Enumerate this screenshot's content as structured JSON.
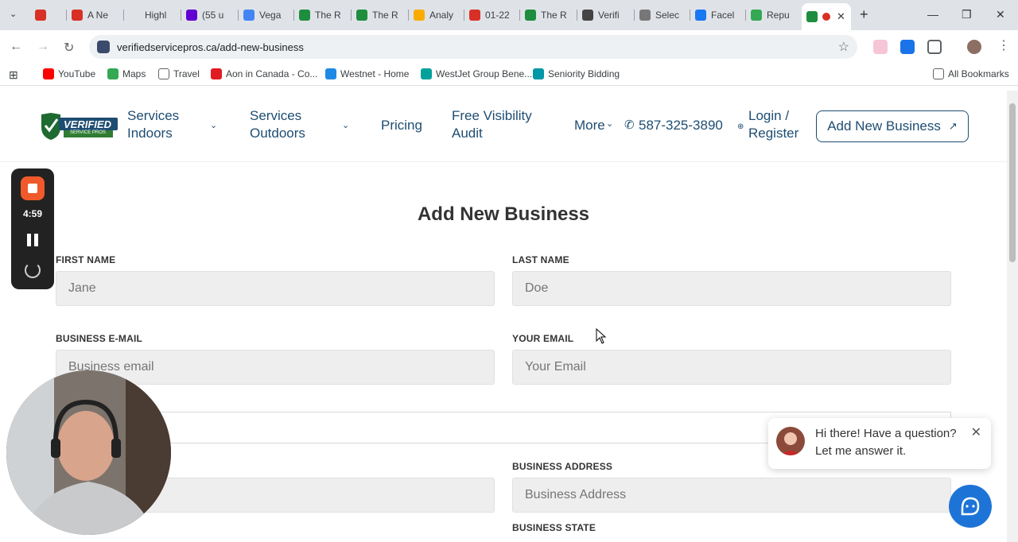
{
  "browser": {
    "tabs": [
      {
        "label": "",
        "icon": "youtube-record-icon",
        "color": "#d93025"
      },
      {
        "label": "A Ne",
        "icon": "gmail-icon",
        "color": "#d93025"
      },
      {
        "label": "Highl",
        "icon": "generic-tab-icon",
        "color": "#dfe3e8"
      },
      {
        "label": "(55 u",
        "icon": "yahoo-mail-icon",
        "color": "#6001d2"
      },
      {
        "label": "Vega",
        "icon": "docs-icon",
        "color": "#4285f4"
      },
      {
        "label": "The R",
        "icon": "site-icon",
        "color": "#1e8e3e"
      },
      {
        "label": "The R",
        "icon": "site-icon",
        "color": "#1e8e3e"
      },
      {
        "label": "Analy",
        "icon": "analytics-icon",
        "color": "#f9ab00"
      },
      {
        "label": "01-22",
        "icon": "sk-icon",
        "color": "#d93025"
      },
      {
        "label": "The R",
        "icon": "site-icon",
        "color": "#1e8e3e"
      },
      {
        "label": "Verifi",
        "icon": "openai-icon",
        "color": "#444444"
      },
      {
        "label": "Selec",
        "icon": "site-icon",
        "color": "#777777"
      },
      {
        "label": "Facel",
        "icon": "facebook-icon",
        "color": "#1877f2"
      },
      {
        "label": "Repu",
        "icon": "plus-icon",
        "color": "#34a853"
      }
    ],
    "active_tab_icon": "verified-icon",
    "new_tab_label": "+",
    "url": "verifiedservicepros.ca/add-new-business",
    "bookmarks": [
      {
        "label": "YouTube",
        "color": "#ff0000"
      },
      {
        "label": "Maps",
        "color": "#34a853"
      },
      {
        "label": "Travel",
        "color": "#ffffff"
      },
      {
        "label": "Aon in Canada - Co...",
        "color": "#e11b22"
      },
      {
        "label": "Westnet - Home",
        "color": "#1e88e5"
      },
      {
        "label": "WestJet Group Bene...",
        "color": "#00a19b"
      },
      {
        "label": "Seniority Bidding",
        "color": "#0097a7"
      }
    ],
    "all_bookmarks": "All Bookmarks"
  },
  "site": {
    "nav": {
      "services_indoors": "Services Indoors",
      "services_outdoors": "Services Outdoors",
      "pricing": "Pricing",
      "free_audit": "Free Visibility Audit",
      "more": "More",
      "phone": "587-325-3890",
      "login": "Login / Register",
      "add_business": "Add New Business",
      "add_business_arrow": "↗"
    },
    "logo_text": "VERIFIED",
    "logo_sub": "SERVICE PROS",
    "form": {
      "title": "Add New Business",
      "first_name_label": "FIRST NAME",
      "first_name_placeholder": "Jane",
      "last_name_label": "LAST NAME",
      "last_name_placeholder": "Doe",
      "business_email_label": "BUSINESS E-MAIL",
      "business_email_placeholder": "Business email",
      "your_email_label": "YOUR EMAIL",
      "your_email_placeholder": "Your Email",
      "business_address_label": "BUSINESS ADDRESS",
      "business_address_placeholder": "Business Address",
      "business_state_label": "BUSINESS STATE"
    },
    "chat": {
      "message": "Hi there! Have a question? Let me answer it."
    }
  },
  "recorder": {
    "time": "4:59"
  },
  "colors": {
    "brand": "#1e4d72",
    "record": "#f05a2a",
    "chat": "#1d74d6"
  }
}
